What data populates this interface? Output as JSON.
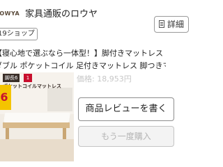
{
  "header": {
    "logo_text": "LOWYA",
    "store_name": "家具通販のロウヤ",
    "detail_label": "詳細",
    "shop_tag": "19ショップ"
  },
  "product": {
    "title_line1": "【寝心地で選ぶなら一体型！】脚付きマットレス ベッド セミ",
    "title_line2": "ダブル ポケットコイル 足付きマットレス 脚つきマットレス・・・",
    "price": "価格: 18,953円",
    "thumbnail": {
      "banner": "脚長6",
      "badge": "1",
      "subtitle": "ポケットコイルマットレス",
      "promo": "6"
    }
  },
  "actions": {
    "review_label": "商品レビューを書く",
    "rebuy_label": "もう一度購入"
  },
  "colors": {
    "accent_red": "#c8102e",
    "promo_yellow": "#f4c400",
    "disabled_text": "#b5b5b5"
  }
}
